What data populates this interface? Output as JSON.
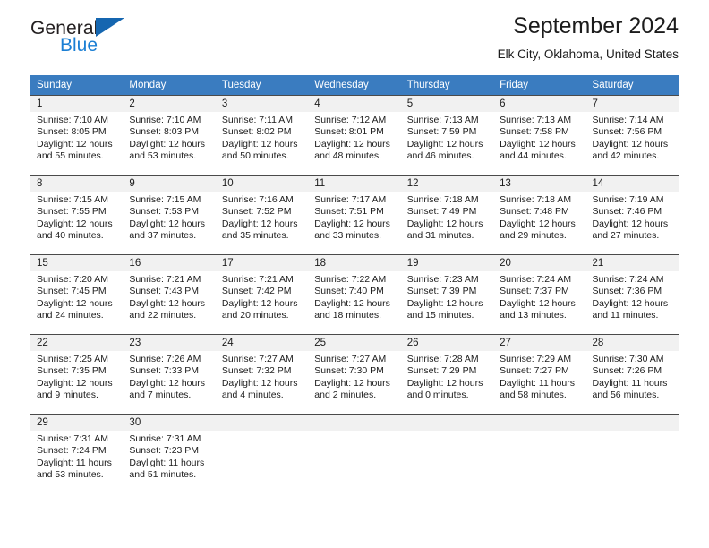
{
  "brand": {
    "name_top": "General",
    "name_bottom": "Blue",
    "triangle_color": "#1566b0",
    "blue_color": "#1b7fd4"
  },
  "header": {
    "title": "September 2024",
    "subtitle": "Elk City, Oklahoma, United States"
  },
  "theme": {
    "header_row_bg": "#3a7cc0",
    "daynum_band_bg": "#f1f1f1",
    "cell_border": "#4a4a4a",
    "text": "#1c1c1c"
  },
  "weekday_headers": [
    "Sunday",
    "Monday",
    "Tuesday",
    "Wednesday",
    "Thursday",
    "Friday",
    "Saturday"
  ],
  "labels": {
    "sunrise_prefix": "Sunrise: ",
    "sunset_prefix": "Sunset: ",
    "daylight_prefix": "Daylight: "
  },
  "days": [
    {
      "num": "1",
      "sunrise": "Sunrise: 7:10 AM",
      "sunset": "Sunset: 8:05 PM",
      "daylight1": "Daylight: 12 hours",
      "daylight2": "and 55 minutes."
    },
    {
      "num": "2",
      "sunrise": "Sunrise: 7:10 AM",
      "sunset": "Sunset: 8:03 PM",
      "daylight1": "Daylight: 12 hours",
      "daylight2": "and 53 minutes."
    },
    {
      "num": "3",
      "sunrise": "Sunrise: 7:11 AM",
      "sunset": "Sunset: 8:02 PM",
      "daylight1": "Daylight: 12 hours",
      "daylight2": "and 50 minutes."
    },
    {
      "num": "4",
      "sunrise": "Sunrise: 7:12 AM",
      "sunset": "Sunset: 8:01 PM",
      "daylight1": "Daylight: 12 hours",
      "daylight2": "and 48 minutes."
    },
    {
      "num": "5",
      "sunrise": "Sunrise: 7:13 AM",
      "sunset": "Sunset: 7:59 PM",
      "daylight1": "Daylight: 12 hours",
      "daylight2": "and 46 minutes."
    },
    {
      "num": "6",
      "sunrise": "Sunrise: 7:13 AM",
      "sunset": "Sunset: 7:58 PM",
      "daylight1": "Daylight: 12 hours",
      "daylight2": "and 44 minutes."
    },
    {
      "num": "7",
      "sunrise": "Sunrise: 7:14 AM",
      "sunset": "Sunset: 7:56 PM",
      "daylight1": "Daylight: 12 hours",
      "daylight2": "and 42 minutes."
    },
    {
      "num": "8",
      "sunrise": "Sunrise: 7:15 AM",
      "sunset": "Sunset: 7:55 PM",
      "daylight1": "Daylight: 12 hours",
      "daylight2": "and 40 minutes."
    },
    {
      "num": "9",
      "sunrise": "Sunrise: 7:15 AM",
      "sunset": "Sunset: 7:53 PM",
      "daylight1": "Daylight: 12 hours",
      "daylight2": "and 37 minutes."
    },
    {
      "num": "10",
      "sunrise": "Sunrise: 7:16 AM",
      "sunset": "Sunset: 7:52 PM",
      "daylight1": "Daylight: 12 hours",
      "daylight2": "and 35 minutes."
    },
    {
      "num": "11",
      "sunrise": "Sunrise: 7:17 AM",
      "sunset": "Sunset: 7:51 PM",
      "daylight1": "Daylight: 12 hours",
      "daylight2": "and 33 minutes."
    },
    {
      "num": "12",
      "sunrise": "Sunrise: 7:18 AM",
      "sunset": "Sunset: 7:49 PM",
      "daylight1": "Daylight: 12 hours",
      "daylight2": "and 31 minutes."
    },
    {
      "num": "13",
      "sunrise": "Sunrise: 7:18 AM",
      "sunset": "Sunset: 7:48 PM",
      "daylight1": "Daylight: 12 hours",
      "daylight2": "and 29 minutes."
    },
    {
      "num": "14",
      "sunrise": "Sunrise: 7:19 AM",
      "sunset": "Sunset: 7:46 PM",
      "daylight1": "Daylight: 12 hours",
      "daylight2": "and 27 minutes."
    },
    {
      "num": "15",
      "sunrise": "Sunrise: 7:20 AM",
      "sunset": "Sunset: 7:45 PM",
      "daylight1": "Daylight: 12 hours",
      "daylight2": "and 24 minutes."
    },
    {
      "num": "16",
      "sunrise": "Sunrise: 7:21 AM",
      "sunset": "Sunset: 7:43 PM",
      "daylight1": "Daylight: 12 hours",
      "daylight2": "and 22 minutes."
    },
    {
      "num": "17",
      "sunrise": "Sunrise: 7:21 AM",
      "sunset": "Sunset: 7:42 PM",
      "daylight1": "Daylight: 12 hours",
      "daylight2": "and 20 minutes."
    },
    {
      "num": "18",
      "sunrise": "Sunrise: 7:22 AM",
      "sunset": "Sunset: 7:40 PM",
      "daylight1": "Daylight: 12 hours",
      "daylight2": "and 18 minutes."
    },
    {
      "num": "19",
      "sunrise": "Sunrise: 7:23 AM",
      "sunset": "Sunset: 7:39 PM",
      "daylight1": "Daylight: 12 hours",
      "daylight2": "and 15 minutes."
    },
    {
      "num": "20",
      "sunrise": "Sunrise: 7:24 AM",
      "sunset": "Sunset: 7:37 PM",
      "daylight1": "Daylight: 12 hours",
      "daylight2": "and 13 minutes."
    },
    {
      "num": "21",
      "sunrise": "Sunrise: 7:24 AM",
      "sunset": "Sunset: 7:36 PM",
      "daylight1": "Daylight: 12 hours",
      "daylight2": "and 11 minutes."
    },
    {
      "num": "22",
      "sunrise": "Sunrise: 7:25 AM",
      "sunset": "Sunset: 7:35 PM",
      "daylight1": "Daylight: 12 hours",
      "daylight2": "and 9 minutes."
    },
    {
      "num": "23",
      "sunrise": "Sunrise: 7:26 AM",
      "sunset": "Sunset: 7:33 PM",
      "daylight1": "Daylight: 12 hours",
      "daylight2": "and 7 minutes."
    },
    {
      "num": "24",
      "sunrise": "Sunrise: 7:27 AM",
      "sunset": "Sunset: 7:32 PM",
      "daylight1": "Daylight: 12 hours",
      "daylight2": "and 4 minutes."
    },
    {
      "num": "25",
      "sunrise": "Sunrise: 7:27 AM",
      "sunset": "Sunset: 7:30 PM",
      "daylight1": "Daylight: 12 hours",
      "daylight2": "and 2 minutes."
    },
    {
      "num": "26",
      "sunrise": "Sunrise: 7:28 AM",
      "sunset": "Sunset: 7:29 PM",
      "daylight1": "Daylight: 12 hours",
      "daylight2": "and 0 minutes."
    },
    {
      "num": "27",
      "sunrise": "Sunrise: 7:29 AM",
      "sunset": "Sunset: 7:27 PM",
      "daylight1": "Daylight: 11 hours",
      "daylight2": "and 58 minutes."
    },
    {
      "num": "28",
      "sunrise": "Sunrise: 7:30 AM",
      "sunset": "Sunset: 7:26 PM",
      "daylight1": "Daylight: 11 hours",
      "daylight2": "and 56 minutes."
    },
    {
      "num": "29",
      "sunrise": "Sunrise: 7:31 AM",
      "sunset": "Sunset: 7:24 PM",
      "daylight1": "Daylight: 11 hours",
      "daylight2": "and 53 minutes."
    },
    {
      "num": "30",
      "sunrise": "Sunrise: 7:31 AM",
      "sunset": "Sunset: 7:23 PM",
      "daylight1": "Daylight: 11 hours",
      "daylight2": "and 51 minutes."
    }
  ]
}
